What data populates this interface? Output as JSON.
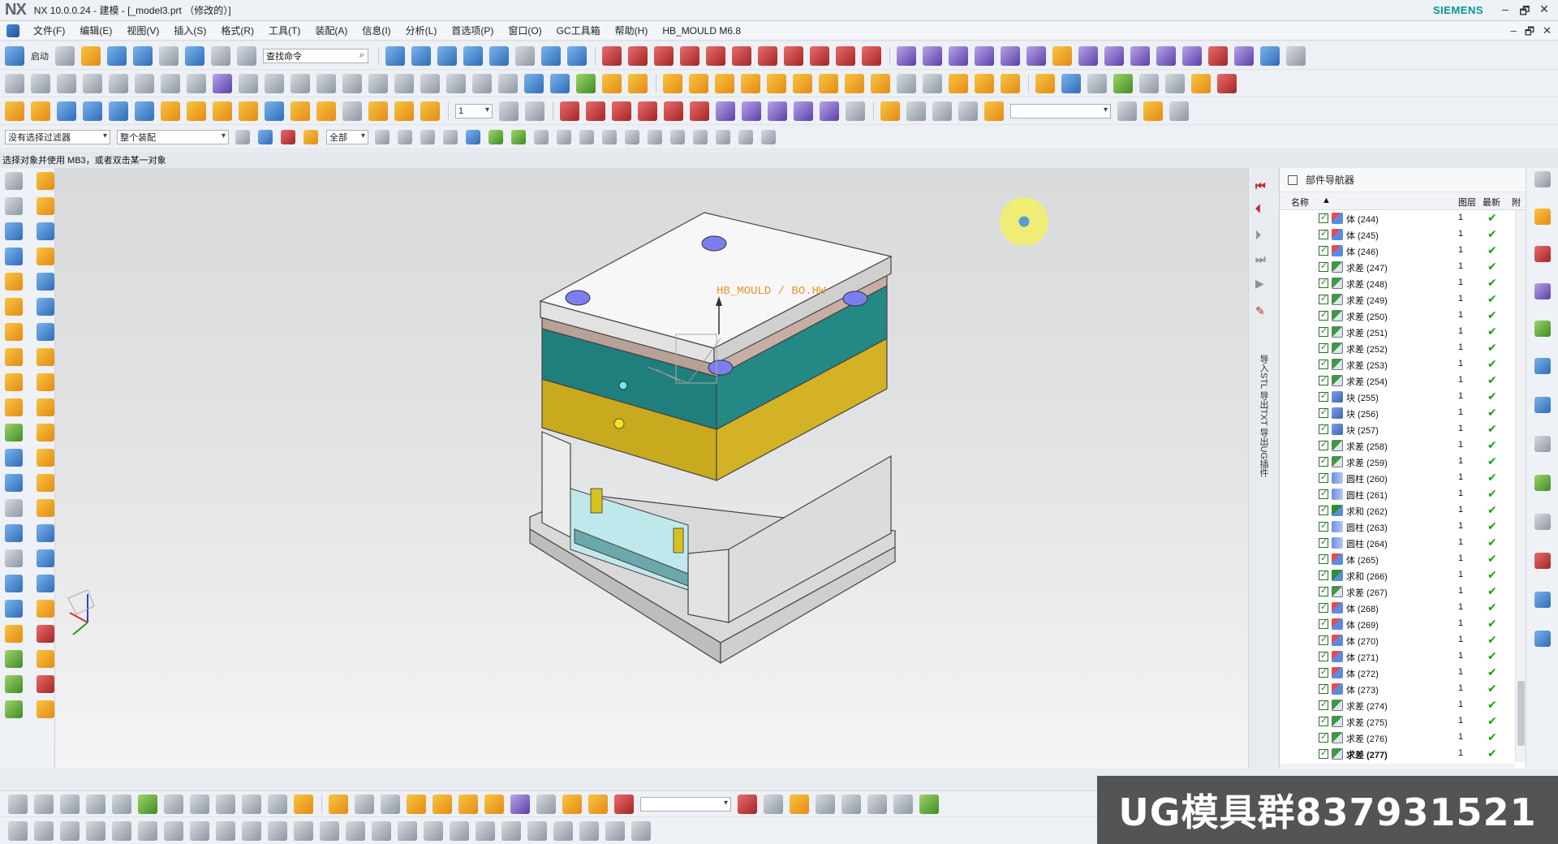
{
  "window": {
    "logo": "NX",
    "title": "NX 10.0.0.24 - 建模 - [_model3.prt （修改的）]",
    "brand": "SIEMENS",
    "controls": [
      "–",
      "🗗",
      "✕"
    ]
  },
  "menu": {
    "items": [
      "文件(F)",
      "编辑(E)",
      "视图(V)",
      "插入(S)",
      "格式(R)",
      "工具(T)",
      "装配(A)",
      "信息(I)",
      "分析(L)",
      "首选项(P)",
      "窗口(O)",
      "GC工具箱",
      "帮助(H)",
      "HB_MOULD M6.8"
    ],
    "doc_controls": [
      "–",
      "🗗",
      "✕"
    ]
  },
  "toolbar": {
    "start_label": "启动",
    "search_placeholder": "查找命令",
    "layer_value": "1",
    "filter_value": "没有选择过滤器",
    "assembly_value": "整个装配",
    "scope_value": "全部"
  },
  "prompt": {
    "text": "选择对象并使用 MB3，或者双击某一对象"
  },
  "viewport": {
    "annotation": "HB_MOULD / BO.HW"
  },
  "side_strip": {
    "vertical_text": "导入STL  导出TXT  导出UG插件"
  },
  "navigator": {
    "title": "部件导航器",
    "columns": {
      "name": "名称",
      "layer": "图层",
      "latest": "最新",
      "extra": "附"
    },
    "rows": [
      {
        "icon": "body",
        "label": "体 (244)",
        "layer": "1"
      },
      {
        "icon": "body",
        "label": "体 (245)",
        "layer": "1"
      },
      {
        "icon": "body",
        "label": "体 (246)",
        "layer": "1"
      },
      {
        "icon": "sub",
        "label": "求差 (247)",
        "layer": "1"
      },
      {
        "icon": "sub",
        "label": "求差 (248)",
        "layer": "1"
      },
      {
        "icon": "sub",
        "label": "求差 (249)",
        "layer": "1"
      },
      {
        "icon": "sub",
        "label": "求差 (250)",
        "layer": "1"
      },
      {
        "icon": "sub",
        "label": "求差 (251)",
        "layer": "1"
      },
      {
        "icon": "sub",
        "label": "求差 (252)",
        "layer": "1"
      },
      {
        "icon": "sub",
        "label": "求差 (253)",
        "layer": "1"
      },
      {
        "icon": "sub",
        "label": "求差 (254)",
        "layer": "1"
      },
      {
        "icon": "blk",
        "label": "块 (255)",
        "layer": "1"
      },
      {
        "icon": "blk",
        "label": "块 (256)",
        "layer": "1"
      },
      {
        "icon": "blk",
        "label": "块 (257)",
        "layer": "1"
      },
      {
        "icon": "sub",
        "label": "求差 (258)",
        "layer": "1"
      },
      {
        "icon": "sub",
        "label": "求差 (259)",
        "layer": "1"
      },
      {
        "icon": "cyl",
        "label": "圆柱 (260)",
        "layer": "1"
      },
      {
        "icon": "cyl",
        "label": "圆柱 (261)",
        "layer": "1"
      },
      {
        "icon": "uni",
        "label": "求和 (262)",
        "layer": "1"
      },
      {
        "icon": "cyl",
        "label": "圆柱 (263)",
        "layer": "1"
      },
      {
        "icon": "cyl",
        "label": "圆柱 (264)",
        "layer": "1"
      },
      {
        "icon": "body",
        "label": "体 (265)",
        "layer": "1"
      },
      {
        "icon": "uni",
        "label": "求和 (266)",
        "layer": "1"
      },
      {
        "icon": "sub",
        "label": "求差 (267)",
        "layer": "1"
      },
      {
        "icon": "body",
        "label": "体 (268)",
        "layer": "1"
      },
      {
        "icon": "body",
        "label": "体 (269)",
        "layer": "1"
      },
      {
        "icon": "body",
        "label": "体 (270)",
        "layer": "1"
      },
      {
        "icon": "body",
        "label": "体 (271)",
        "layer": "1"
      },
      {
        "icon": "body",
        "label": "体 (272)",
        "layer": "1"
      },
      {
        "icon": "body",
        "label": "体 (273)",
        "layer": "1"
      },
      {
        "icon": "sub",
        "label": "求差 (274)",
        "layer": "1"
      },
      {
        "icon": "sub",
        "label": "求差 (275)",
        "layer": "1"
      },
      {
        "icon": "sub",
        "label": "求差 (276)",
        "layer": "1"
      },
      {
        "icon": "sub",
        "label": "求差 (277)",
        "layer": "1"
      }
    ]
  },
  "watermark": {
    "text": "UG模具群837931521"
  },
  "colors": {
    "siemens": "#009999",
    "teal_plate": "#1f7f7c",
    "yellow_plate": "#c9a91e",
    "check_green": "#14a514"
  }
}
